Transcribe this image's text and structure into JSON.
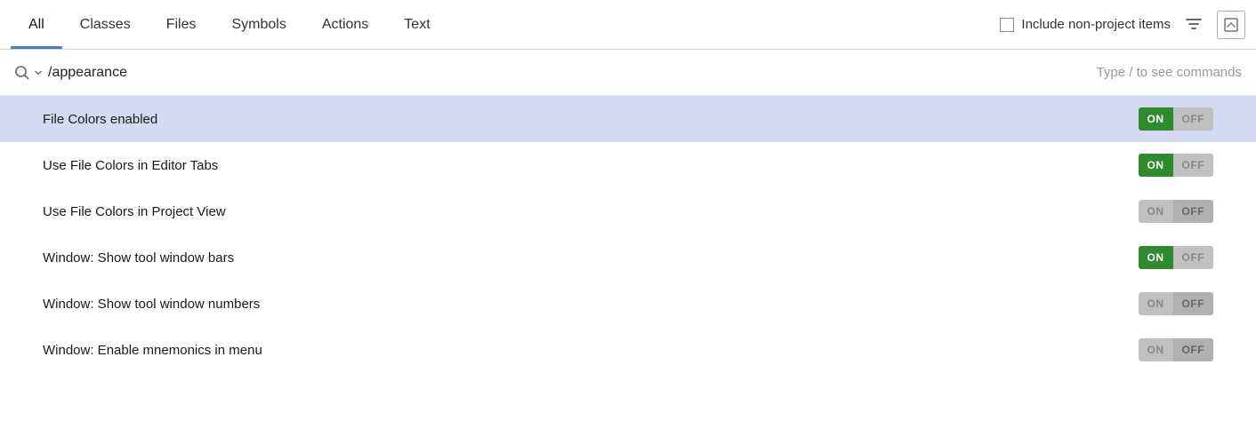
{
  "tabs": [
    {
      "id": "all",
      "label": "All",
      "active": true
    },
    {
      "id": "classes",
      "label": "Classes",
      "active": false
    },
    {
      "id": "files",
      "label": "Files",
      "active": false
    },
    {
      "id": "symbols",
      "label": "Symbols",
      "active": false
    },
    {
      "id": "actions",
      "label": "Actions",
      "active": false
    },
    {
      "id": "text",
      "label": "Text",
      "active": false
    }
  ],
  "include_non_project": {
    "label": "Include non-project items",
    "checked": false
  },
  "search": {
    "placeholder": "/appearance",
    "value": "/appearance",
    "hint": "Type / to see commands"
  },
  "results": [
    {
      "id": "file-colors-enabled",
      "label": "File Colors enabled",
      "selected": true,
      "toggle_state": "on"
    },
    {
      "id": "use-file-colors-editor",
      "label": "Use File Colors in Editor Tabs",
      "selected": false,
      "toggle_state": "on"
    },
    {
      "id": "use-file-colors-project",
      "label": "Use File Colors in Project View",
      "selected": false,
      "toggle_state": "off"
    },
    {
      "id": "window-show-tool-bars",
      "label": "Window: Show tool window bars",
      "selected": false,
      "toggle_state": "on"
    },
    {
      "id": "window-show-tool-numbers",
      "label": "Window: Show tool window numbers",
      "selected": false,
      "toggle_state": "off"
    },
    {
      "id": "window-enable-mnemonics",
      "label": "Window: Enable mnemonics in  menu",
      "selected": false,
      "toggle_state": "off"
    }
  ],
  "icons": {
    "search": "🔍",
    "filter": "⛉",
    "collapse": "⊡"
  }
}
